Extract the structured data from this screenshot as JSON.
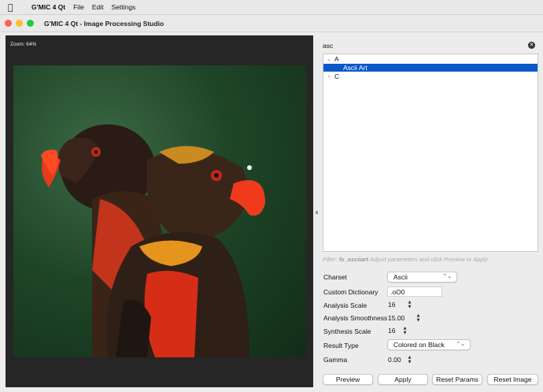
{
  "menubar": {
    "app_name": "G'MIC 4 Qt",
    "items": [
      "File",
      "Edit",
      "Settings"
    ]
  },
  "window": {
    "title": "G'MIC 4 Qt - Image Processing Studio"
  },
  "preview": {
    "zoom_label": "Zoom: 64%"
  },
  "search": {
    "value": "asc"
  },
  "tree": {
    "items": [
      {
        "label": "A",
        "expanded": true
      },
      {
        "label": "Ascii Art",
        "selected": true
      },
      {
        "label": "C",
        "expanded": false
      }
    ]
  },
  "filter_note": {
    "prefix": "Filter:",
    "command": "fx_asciiart",
    "suffix": "Adjust parameters and click Preview or Apply"
  },
  "params": {
    "charset": {
      "label": "Charset",
      "value": "Ascii"
    },
    "custom_dictionary": {
      "label": "Custom Dictionary",
      "value": ".oO0"
    },
    "analysis_scale": {
      "label": "Analysis Scale",
      "value": "16"
    },
    "analysis_smoothness": {
      "label": "Analysis Smoothness",
      "value": "15.00"
    },
    "synthesis_scale": {
      "label": "Synthesis Scale",
      "value": "16"
    },
    "result_type": {
      "label": "Result Type",
      "value": "Colored on Black"
    },
    "gamma": {
      "label": "Gamma",
      "value": "0.00"
    }
  },
  "buttons": {
    "preview": "Preview",
    "apply": "Apply",
    "reset_params": "Reset Params",
    "reset_image": "Reset Image"
  },
  "colors": {
    "selection": "#0a58ca",
    "preview_bg": "#262626"
  }
}
